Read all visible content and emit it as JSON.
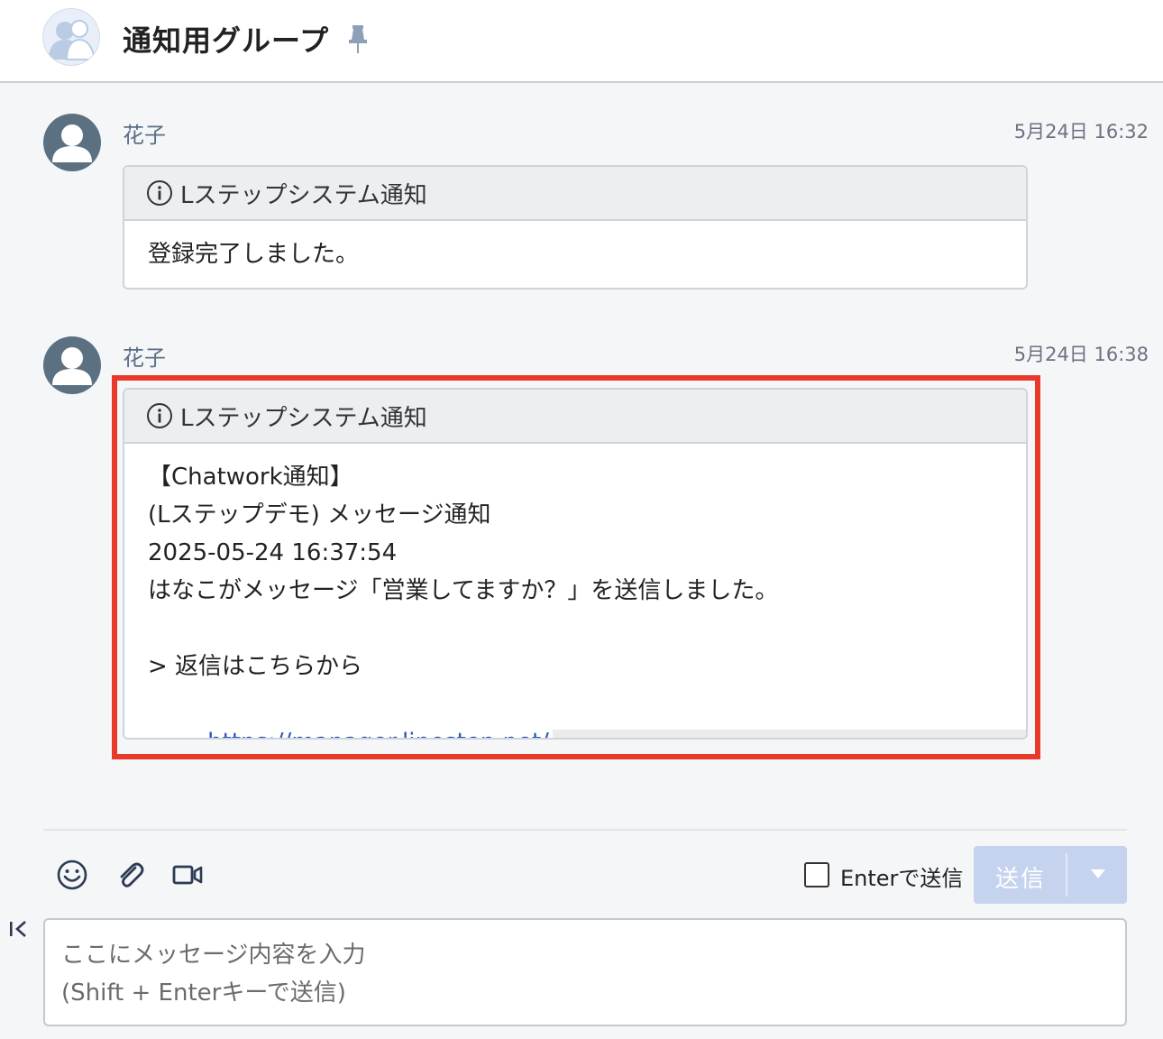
{
  "header": {
    "title": "通知用グループ",
    "avatar_icon": "group-avatar-icon",
    "pin_icon": "pin-icon"
  },
  "messages": [
    {
      "sender": "花子",
      "timestamp": "5月24日 16:32",
      "card_title": "Lステップシステム通知",
      "body": [
        "登録完了しました。"
      ]
    },
    {
      "sender": "花子",
      "timestamp": "5月24日 16:38",
      "card_title": "Lステップシステム通知",
      "body": [
        "【Chatwork通知】",
        "(Lステップデモ) メッセージ通知",
        "2025-05-24 16:37:54",
        "はなこがメッセージ「営業してますか？」を送信しました。",
        "",
        "> 返信はこちらから"
      ],
      "link": "https://manager.linestep.net/",
      "highlighted": true
    }
  ],
  "composer": {
    "enter_to_send_label": "Enterで送信",
    "enter_to_send_checked": false,
    "send_label": "送信",
    "placeholder_line1": "ここにメッセージ内容を入力",
    "placeholder_line2": "(Shift + Enterキーで送信)",
    "icons": [
      "emoji-icon",
      "attachment-icon",
      "video-call-icon",
      "collapse-icon"
    ]
  },
  "colors": {
    "highlight_border": "#e8392b",
    "link": "#2a55b8",
    "send_button": "#c5d3ee"
  }
}
